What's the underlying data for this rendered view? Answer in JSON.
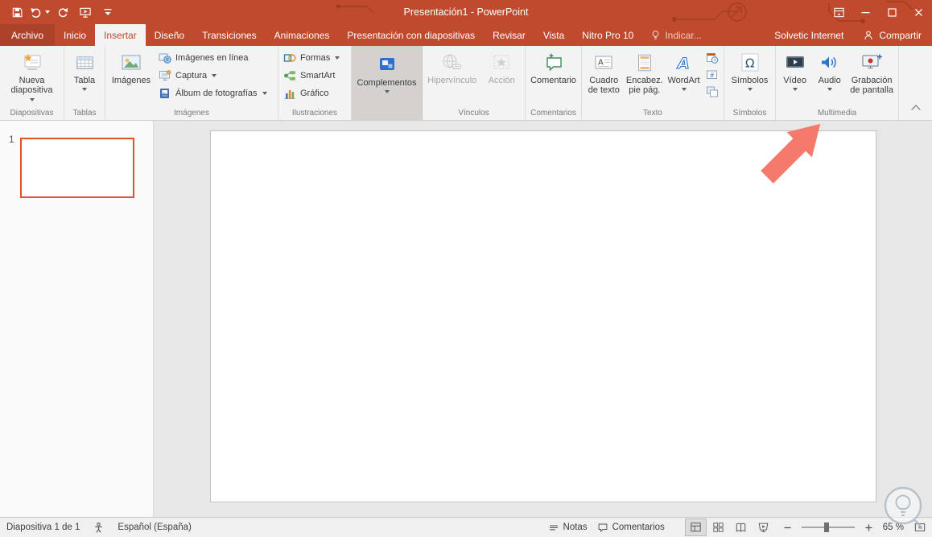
{
  "colors": {
    "titlebar": "#C04A2E",
    "active_tab_text": "#C04A2E",
    "ribbon_bg": "#F3F3F3",
    "selected_button_bg": "#D4D1CE",
    "thumbnail_border": "#E2502C",
    "arrow": "#F47B6B"
  },
  "glyphs": {
    "omega": "Ω",
    "hash": "#",
    "letter_a": "A",
    "wordart_a": "A"
  },
  "titlebar": {
    "title": "Presentación1 - PowerPoint"
  },
  "tabs": {
    "archivo": "Archivo",
    "inicio": "Inicio",
    "insertar": "Insertar",
    "diseno": "Diseño",
    "transiciones": "Transiciones",
    "animaciones": "Animaciones",
    "presentacion": "Presentación con diapositivas",
    "revisar": "Revisar",
    "vista": "Vista",
    "nitro": "Nitro Pro 10",
    "tellme": "Indicar...",
    "solvetic": "Solvetic Internet",
    "compartir": "Compartir"
  },
  "ribbon": {
    "slides": {
      "group": "Diapositivas",
      "new_slide": "Nueva diapositiva"
    },
    "tables": {
      "group": "Tablas",
      "table": "Tabla"
    },
    "images": {
      "group": "Imágenes",
      "pictures": "Imágenes",
      "online": "Imágenes en línea",
      "capture": "Captura",
      "album": "Álbum de fotografías"
    },
    "illustrations": {
      "group": "Ilustraciones",
      "shapes": "Formas",
      "smartart": "SmartArt",
      "chart": "Gráfico"
    },
    "addins": {
      "button": "Complementos"
    },
    "links": {
      "group": "Vínculos",
      "hyperlink": "Hipervínculo",
      "action": "Acción"
    },
    "comments": {
      "group": "Comentarios",
      "comment": "Comentario"
    },
    "text": {
      "group": "Texto",
      "textbox": "Cuadro de texto",
      "headerfooter": "Encabez. pie pág.",
      "wordart": "WordArt"
    },
    "symbols": {
      "group": "Símbolos",
      "symbols": "Símbolos"
    },
    "media": {
      "group": "Multimedia",
      "video": "Vídeo",
      "audio": "Audio",
      "screen_recording": "Grabación de pantalla"
    }
  },
  "slidepanel": {
    "slide_number": "1"
  },
  "statusbar": {
    "slide_info": "Diapositiva 1 de 1",
    "language": "Español (España)",
    "notes": "Notas",
    "comments": "Comentarios",
    "zoom": "65 %"
  }
}
